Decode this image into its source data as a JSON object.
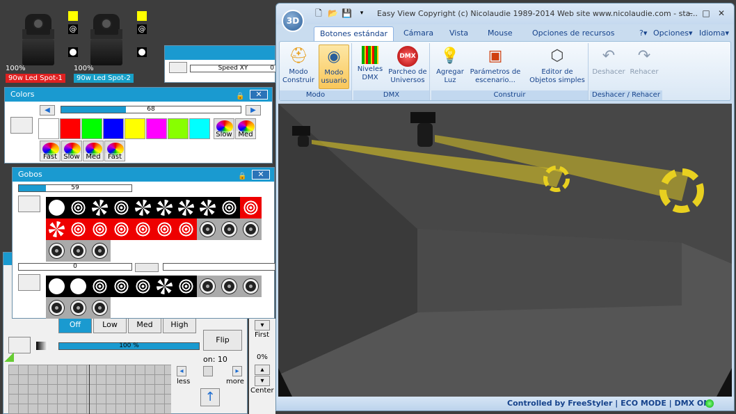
{
  "fixtures": [
    {
      "percent": "100%",
      "name": "90w Led Spot-1",
      "color": "#e02020"
    },
    {
      "percent": "100%",
      "name": "90w Led Spot-2",
      "color": "#17a0c8"
    }
  ],
  "speed_panel": {
    "label": "Speed XY",
    "value": "0"
  },
  "colors_panel": {
    "title": "Colors",
    "slider_value": "68",
    "slider_fraction": 0.36,
    "swatches": [
      "#ffffff",
      "#ff0000",
      "#00ff00",
      "#0000ff",
      "#ffff00",
      "#ff00ff",
      "#88ff00",
      "#00ffff"
    ],
    "row1_wheels": [
      "Slow",
      "Med"
    ],
    "row2_wheels": [
      "Fast",
      "Slow",
      "Med",
      "Fast"
    ]
  },
  "gobos_panel": {
    "title": "Gobos",
    "slider1_value": "59",
    "slider1_fraction": 0.24,
    "slider2_value": "0",
    "slider2_fraction": 0
  },
  "lower_panel": {
    "intensity_buttons": [
      "Off",
      "Low",
      "Med",
      "High"
    ],
    "dimmer_value": "100 %",
    "dimmer_fraction": 1.0,
    "flip_label": "Flip",
    "first_label": "First",
    "percent_label": "0%",
    "center_label": "Center",
    "less_label": "less",
    "more_label": "more",
    "option_text": "on: 10"
  },
  "window": {
    "orb": "3D",
    "title": "Easy View   Copyright (c) Nicolaudie 1989-2014   Web site www.nicolaudie.com - sta...",
    "tabs": [
      "Botones estándar",
      "Cámara",
      "Vista",
      "Mouse",
      "Opciones de recursos"
    ],
    "right_menu": [
      "?",
      "Opciones",
      "Idioma"
    ],
    "groups": [
      {
        "label": "Modo",
        "buttons": [
          "Modo Construir",
          "Modo usuario"
        ]
      },
      {
        "label": "DMX",
        "buttons": [
          "Niveles DMX",
          "Parcheo de Universos"
        ]
      },
      {
        "label": "Construir",
        "buttons": [
          "Agregar Luz",
          "Parámetros de escenario...",
          "Editor de Objetos simples"
        ]
      },
      {
        "label": "Deshacer / Rehacer",
        "buttons": [
          "Deshacer",
          "Rehacer"
        ]
      }
    ],
    "status": "Controlled by FreeStyler  |  ECO MODE  |  DMX ON"
  },
  "colors": {
    "accent": "#1a9ad0",
    "beam": "#e8d020"
  }
}
